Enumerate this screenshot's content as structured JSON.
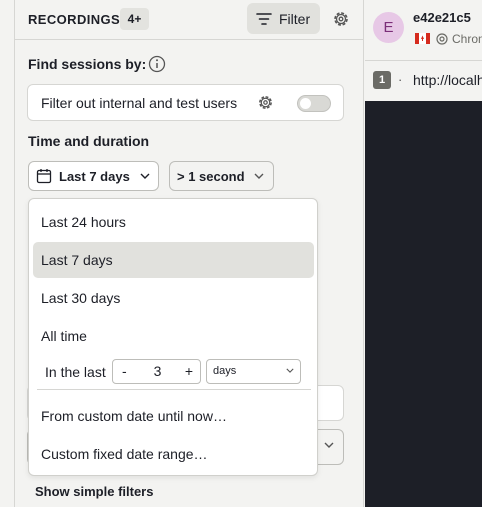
{
  "header": {
    "title": "RECORDINGS",
    "count": "4+",
    "filter_label": "Filter"
  },
  "filters": {
    "find_label": "Find sessions by:",
    "internal_filter_label": "Filter out internal and test users",
    "internal_filter_on": false
  },
  "time": {
    "section_label": "Time and duration",
    "date_range_value": "Last 7 days",
    "duration_value": "> 1 second"
  },
  "dropdown": {
    "items": [
      {
        "label": "Last 24 hours",
        "active": false
      },
      {
        "label": "Last 7 days",
        "active": true
      },
      {
        "label": "Last 30 days",
        "active": false
      },
      {
        "label": "All time",
        "active": false
      }
    ],
    "in_last_label": "In the last",
    "stepper_minus": "-",
    "stepper_value": "3",
    "stepper_plus": "+",
    "unit_value": "days",
    "custom_until_now": "From custom date until now…",
    "custom_fixed": "Custom fixed date range…"
  },
  "footer": {
    "simple_filters_label": "Show simple filters"
  },
  "session": {
    "avatar_letter": "E",
    "id": "e42e21c5",
    "browser": "Chrome",
    "page_number": "1",
    "page_sep": "·",
    "url": "http://localhost"
  },
  "colors": {
    "background": "#f3f3f1",
    "active_item": "#e1e1dd",
    "avatar_bg": "#e7c8e6",
    "player_bg": "#1d1f27"
  }
}
